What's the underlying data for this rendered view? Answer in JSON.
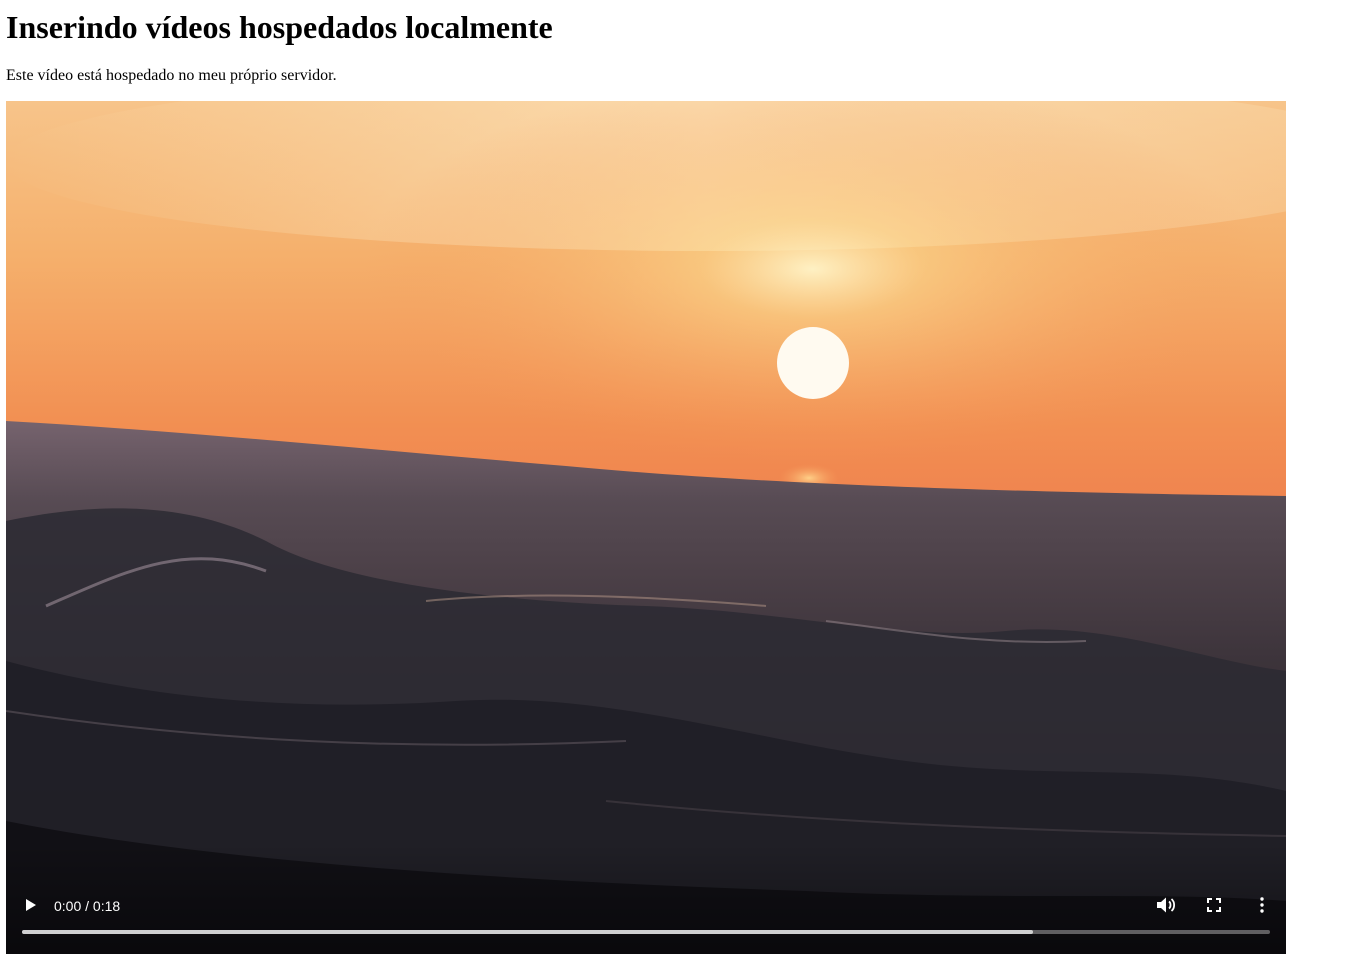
{
  "page": {
    "title": "Inserindo vídeos hospedados localmente",
    "description": "Este vídeo está hospedado no meu próprio servidor."
  },
  "video": {
    "scene": "sunset-over-ocean-waves",
    "time_display": "0:00 / 0:18",
    "current_time": "0:00",
    "duration": "0:18",
    "buffered_fraction": 0.81,
    "played_fraction": 0.0,
    "icons": {
      "play": "play-icon",
      "volume": "volume-icon",
      "fullscreen": "fullscreen-icon",
      "more": "more-vertical-icon"
    }
  }
}
